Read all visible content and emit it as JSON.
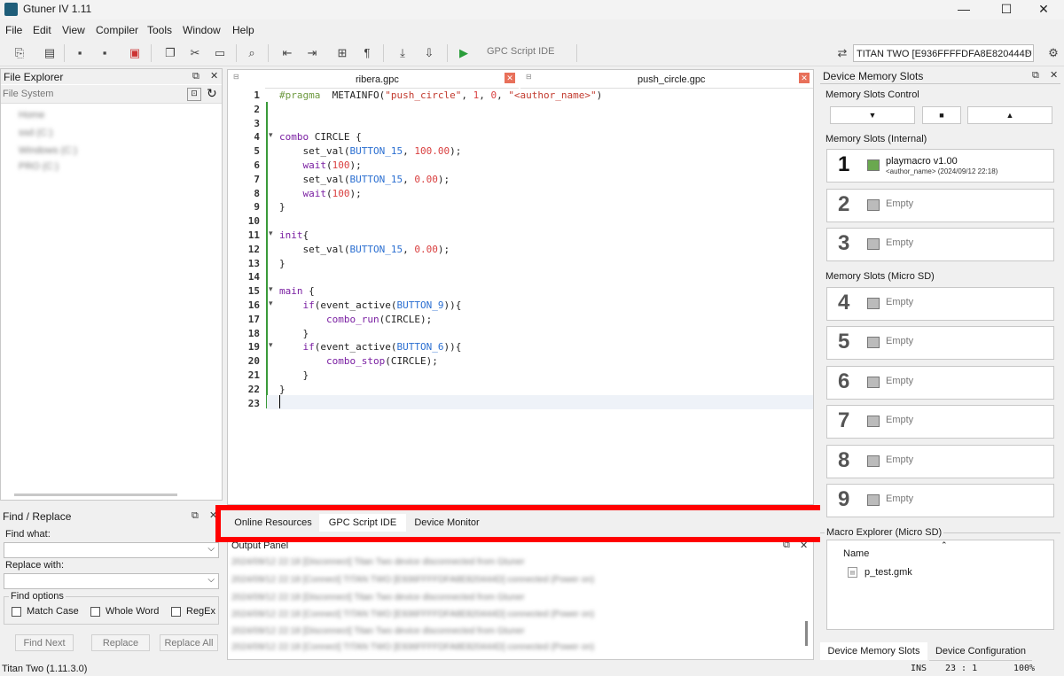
{
  "window": {
    "title": "Gtuner IV 1.11",
    "minimize": "—",
    "maximize": "☐",
    "close": "✕"
  },
  "menu": [
    "File",
    "Edit",
    "View",
    "Compiler",
    "Tools",
    "Window",
    "Help"
  ],
  "toolbar": {
    "gpc_ide_label": "GPC Script IDE",
    "device": "TITAN TWO [E936FFFFDFA8E820444D"
  },
  "file_explorer": {
    "title": "File Explorer",
    "fs_label": "File System",
    "tree": [
      "Home",
      "ssd (C:)",
      "Windows (C:)",
      "PRO (C:)"
    ]
  },
  "find_replace": {
    "title": "Find / Replace",
    "find_what": "Find what:",
    "replace_with": "Replace with:",
    "find_options": "Find options",
    "match_case": "Match Case",
    "whole_word": "Whole Word",
    "regex": "RegEx",
    "find_next": "Find Next",
    "replace": "Replace",
    "replace_all": "Replace All"
  },
  "editor": {
    "tabs": [
      {
        "label": "ribera.gpc"
      },
      {
        "label": "push_circle.gpc"
      }
    ],
    "line_numbers": [
      "1",
      "2",
      "3",
      "4",
      "5",
      "6",
      "7",
      "8",
      "9",
      "10",
      "11",
      "12",
      "13",
      "14",
      "15",
      "16",
      "17",
      "18",
      "19",
      "20",
      "21",
      "22",
      "23"
    ]
  },
  "bottom_tabs": [
    "Online Resources",
    "GPC Script IDE",
    "Device Monitor"
  ],
  "output": {
    "title": "Output Panel",
    "lines": [
      "2024/09/12 22:18 [Disconnect] Titan Two device disconnected from Gtuner",
      "2024/09/12 22:18 [Connect] TITAN TWO [E936FFFFDFA8E820444D] connected (Power on)",
      "2024/09/12 22:18 [Disconnect] Titan Two device disconnected from Gtuner",
      "2024/09/12 22:18 [Connect] TITAN TWO [E936FFFFDFA8E820444D] connected (Power on)",
      "2024/09/12 22:18 [Disconnect] Titan Two device disconnected from Gtuner",
      "2024/09/12 22:18 [Connect] TITAN TWO [E936FFFFDFA8E820444D] connected (Power on)"
    ]
  },
  "memory": {
    "title": "Device Memory Slots",
    "control": "Memory Slots Control",
    "internal": "Memory Slots (Internal)",
    "microsd": "Memory Slots (Micro SD)",
    "slot1_name": "playmacro v1.00",
    "slot1_meta": "<author_name> (2024/09/12 22:18)",
    "empty": "Empty",
    "slots": [
      "1",
      "2",
      "3",
      "4",
      "5",
      "6",
      "7",
      "8",
      "9"
    ],
    "macro_explorer": "Macro Explorer (Micro SD)",
    "name_col": "Name",
    "file": "p_test.gmk",
    "tab_slots": "Device Memory Slots",
    "tab_config": "Device Configuration"
  },
  "status": {
    "left": "Titan Two (1.11.3.0)",
    "mode": "INS",
    "pos": "23 : 1",
    "zoom": "100%"
  },
  "colors": {
    "highlight": "#ff0000",
    "keyword": "#7a1fa2",
    "constant": "#2b6fd1",
    "number": "#d94040"
  }
}
